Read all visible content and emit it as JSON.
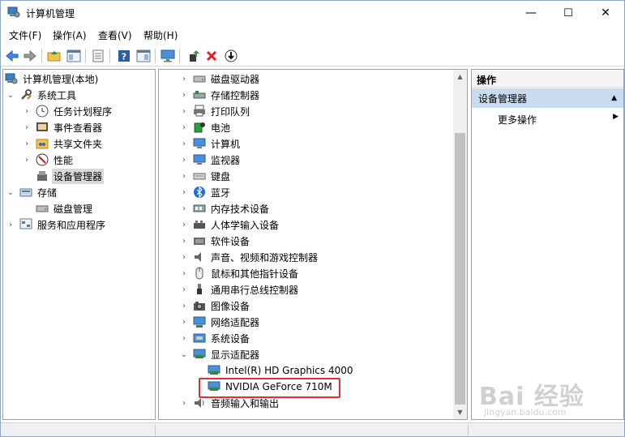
{
  "window": {
    "title": "计算机管理",
    "min_glyph": "—",
    "max_glyph": "☐",
    "close_glyph": "✕"
  },
  "menu": {
    "items": [
      "文件(F)",
      "操作(A)",
      "查看(V)",
      "帮助(H)"
    ]
  },
  "toolbar": {
    "icons": [
      "back-icon",
      "forward-icon",
      "up-folder-icon",
      "show-hide-tree-icon",
      "properties-icon",
      "help-icon",
      "show-action-pane-icon",
      "monitor-icon",
      "update-driver-icon",
      "uninstall-icon",
      "disable-device-icon"
    ]
  },
  "left_tree": {
    "root": "计算机管理(本地)",
    "system_tools": "系统工具",
    "task_scheduler": "任务计划程序",
    "event_viewer": "事件查看器",
    "shared_folders": "共享文件夹",
    "performance": "性能",
    "device_manager": "设备管理器",
    "storage": "存储",
    "disk_management": "磁盘管理",
    "services_apps": "服务和应用程序"
  },
  "device_tree": {
    "items": [
      {
        "label": "磁盘驱动器",
        "icon": "disk-drive-icon",
        "expanded": false
      },
      {
        "label": "存储控制器",
        "icon": "storage-controller-icon",
        "expanded": false
      },
      {
        "label": "打印队列",
        "icon": "printer-icon",
        "expanded": false
      },
      {
        "label": "电池",
        "icon": "battery-icon",
        "expanded": false
      },
      {
        "label": "计算机",
        "icon": "computer-icon",
        "expanded": false
      },
      {
        "label": "监视器",
        "icon": "monitor-icon",
        "expanded": false
      },
      {
        "label": "键盘",
        "icon": "keyboard-icon",
        "expanded": false
      },
      {
        "label": "蓝牙",
        "icon": "bluetooth-icon",
        "expanded": false
      },
      {
        "label": "内存技术设备",
        "icon": "memory-device-icon",
        "expanded": false
      },
      {
        "label": "人体学输入设备",
        "icon": "hid-icon",
        "expanded": false
      },
      {
        "label": "软件设备",
        "icon": "software-device-icon",
        "expanded": false
      },
      {
        "label": "声音、视频和游戏控制器",
        "icon": "speaker-icon",
        "expanded": false
      },
      {
        "label": "鼠标和其他指针设备",
        "icon": "mouse-icon",
        "expanded": false
      },
      {
        "label": "通用串行总线控制器",
        "icon": "usb-icon",
        "expanded": false
      },
      {
        "label": "图像设备",
        "icon": "camera-icon",
        "expanded": false
      },
      {
        "label": "网络适配器",
        "icon": "network-adapter-icon",
        "expanded": false
      },
      {
        "label": "系统设备",
        "icon": "system-device-icon",
        "expanded": false
      },
      {
        "label": "显示适配器",
        "icon": "display-adapter-icon",
        "expanded": true
      },
      {
        "label": "Intel(R) HD Graphics 4000",
        "icon": "display-adapter-icon",
        "child": true
      },
      {
        "label": "NVIDIA GeForce 710M",
        "icon": "display-adapter-icon",
        "child": true,
        "highlighted": true
      },
      {
        "label": "音频输入和输出",
        "icon": "audio-io-icon",
        "expanded": false
      }
    ]
  },
  "actions": {
    "header": "操作",
    "section": "设备管理器",
    "more": "更多操作"
  },
  "watermark": {
    "main": "Bai 经验",
    "sub": "jingyan.baidu.com"
  }
}
